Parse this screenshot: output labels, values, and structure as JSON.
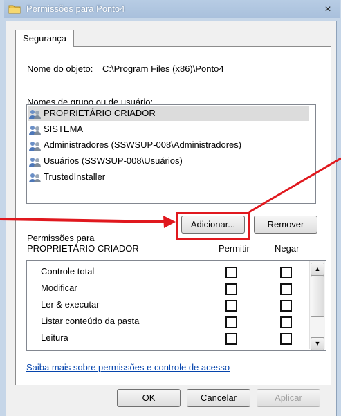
{
  "window": {
    "title": "Permissões para Ponto4",
    "close_label": "×"
  },
  "tabs": [
    {
      "label": "Segurança"
    }
  ],
  "object": {
    "label": "Nome do objeto:",
    "value": "C:\\Program Files (x86)\\Ponto4"
  },
  "users": {
    "label": "Nomes de grupo ou de usuário:",
    "items": [
      {
        "label": "PROPRIETÁRIO CRIADOR",
        "selected": true
      },
      {
        "label": "SISTEMA",
        "selected": false
      },
      {
        "label": "Administradores (SSWSUP-008\\Administradores)",
        "selected": false
      },
      {
        "label": "Usuários (SSWSUP-008\\Usuários)",
        "selected": false
      },
      {
        "label": "TrustedInstaller",
        "selected": false
      }
    ]
  },
  "buttons": {
    "add": "Adicionar...",
    "remove": "Remover",
    "ok": "OK",
    "cancel": "Cancelar",
    "apply": "Aplicar"
  },
  "permissions": {
    "label_line1": "Permissões para",
    "label_line2": "PROPRIETÁRIO CRIADOR",
    "col_allow": "Permitir",
    "col_deny": "Negar",
    "rows": [
      {
        "label": "Controle total",
        "allow": false,
        "deny": false
      },
      {
        "label": "Modificar",
        "allow": false,
        "deny": false
      },
      {
        "label": "Ler & executar",
        "allow": false,
        "deny": false
      },
      {
        "label": "Listar conteúdo da pasta",
        "allow": false,
        "deny": false
      },
      {
        "label": "Leitura",
        "allow": false,
        "deny": false
      }
    ]
  },
  "link": {
    "learn_more": "Saiba mais sobre permissões e controle de acesso"
  },
  "colors": {
    "annotation": "#e0181e",
    "link": "#0645ad"
  },
  "icons": {
    "title": "folder-icon",
    "user": "users-group-icon"
  }
}
